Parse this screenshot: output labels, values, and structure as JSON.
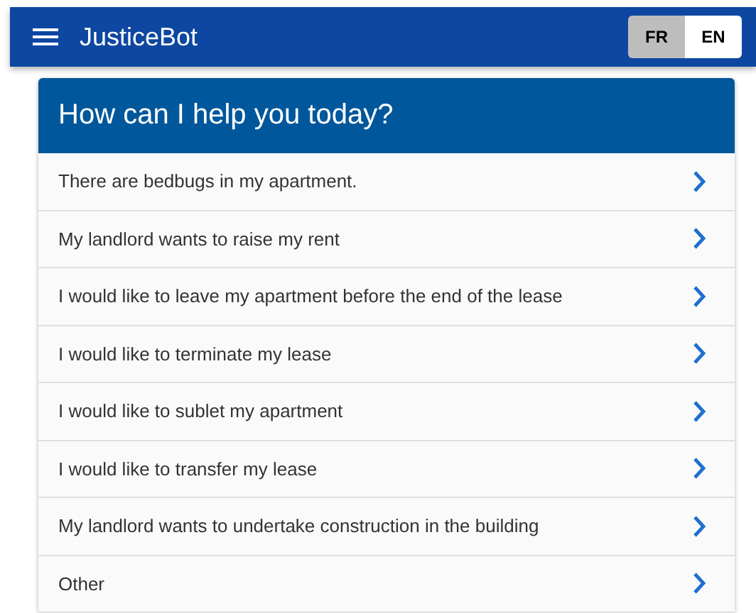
{
  "app_bar": {
    "title": "JusticeBot",
    "languages": [
      {
        "label": "FR",
        "selected": true
      },
      {
        "label": "EN",
        "selected": false
      }
    ]
  },
  "card": {
    "title": "How can I help you today?",
    "options": [
      {
        "label": "There are bedbugs in my apartment."
      },
      {
        "label": "My landlord wants to raise my rent"
      },
      {
        "label": "I would like to leave my apartment before the end of the lease"
      },
      {
        "label": "I would like to terminate my lease"
      },
      {
        "label": "I would like to sublet my apartment"
      },
      {
        "label": "I would like to transfer my lease"
      },
      {
        "label": "My landlord wants to undertake construction in the building"
      },
      {
        "label": "Other"
      }
    ]
  }
}
